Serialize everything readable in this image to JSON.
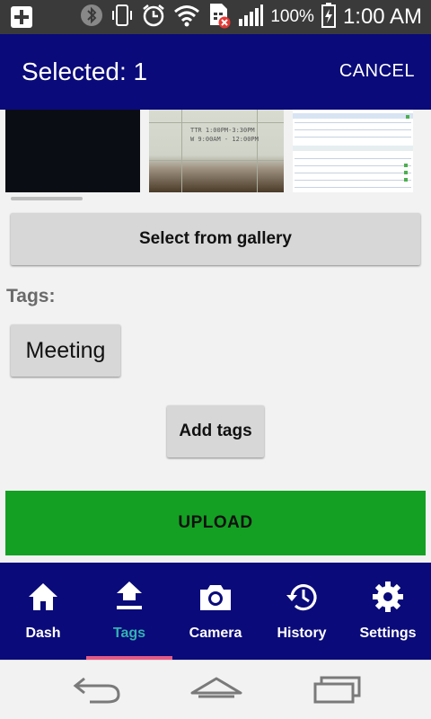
{
  "status_bar": {
    "battery_percent": "100%",
    "time": "1:00 AM",
    "icons": [
      "plus-box-icon",
      "bluetooth-icon",
      "phone-vibrate-icon",
      "alarm-icon",
      "wifi-icon",
      "sim-error-icon",
      "signal-icon",
      "battery-charging-icon"
    ]
  },
  "header": {
    "title": "Selected: 1",
    "cancel_label": "CANCEL",
    "background": "#0a0a7a"
  },
  "thumbnails": [
    {
      "kind": "dark-photo"
    },
    {
      "kind": "schedule-photo",
      "lines": [
        "TTR 1:00PM-3:30PM",
        "W 9:00AM - 12:00PM"
      ]
    },
    {
      "kind": "document-screenshot"
    }
  ],
  "gallery_button": {
    "label": "Select from gallery"
  },
  "tags": {
    "label": "Tags:",
    "items": [
      "Meeting"
    ],
    "add_label": "Add tags"
  },
  "upload_button": {
    "label": "UPLOAD",
    "color": "#14a022"
  },
  "bottom_nav": {
    "items": [
      {
        "label": "Dash",
        "icon": "home-icon",
        "active": false
      },
      {
        "label": "Tags",
        "icon": "upload-icon",
        "active": true
      },
      {
        "label": "Camera",
        "icon": "camera-icon",
        "active": false
      },
      {
        "label": "History",
        "icon": "history-icon",
        "active": false
      },
      {
        "label": "Settings",
        "icon": "gear-icon",
        "active": false
      }
    ],
    "active_color": "#33b2b0",
    "indicator_color": "#e45a86"
  },
  "system_nav": {
    "buttons": [
      "back-icon",
      "home-outline-icon",
      "recents-icon"
    ]
  }
}
